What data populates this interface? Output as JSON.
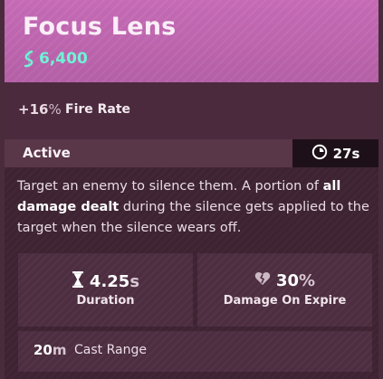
{
  "item": {
    "title": "Focus Lens",
    "price": "6,400",
    "price_icon": "souls-icon"
  },
  "stat": {
    "value": "+16",
    "unit": "%",
    "label": "Fire Rate"
  },
  "active": {
    "label": "Active",
    "cooldown": "27s",
    "cooldown_icon": "cooldown-clock-icon"
  },
  "description": {
    "part1": "Target an enemy to silence them. A portion of ",
    "bold": "all damage dealt",
    "part2": " during the silence gets applied to the target when the silence wears off."
  },
  "properties": {
    "duration": {
      "value": "4.25",
      "unit": "s",
      "label": "Duration",
      "icon": "hourglass-icon"
    },
    "damage_on_expire": {
      "value": "30",
      "unit": "%",
      "label": "Damage On Expire",
      "icon": "broken-heart-icon"
    },
    "cast_range": {
      "value": "20",
      "unit": "m",
      "label": "Cast Range"
    }
  },
  "colors": {
    "header": "#c56ab5",
    "price": "#6ff3d6",
    "card": "#3e2332",
    "cooldown_bg": "#1e1018"
  }
}
